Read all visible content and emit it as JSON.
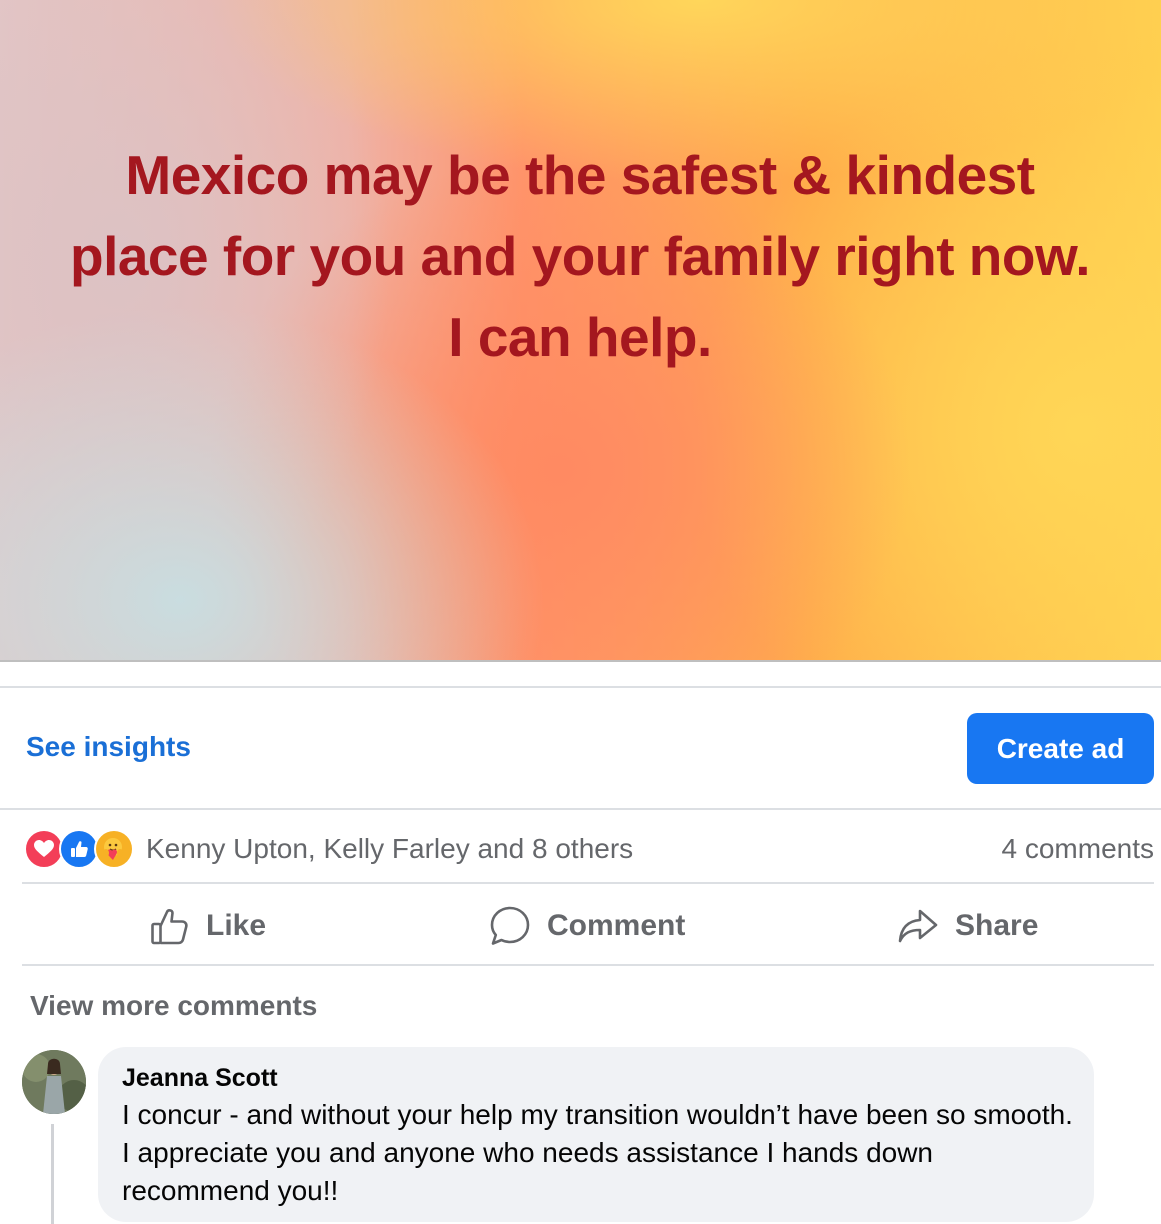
{
  "post": {
    "text": "Mexico may be the safest & kindest place for you and your family right now. I can help."
  },
  "insights": {
    "see_insights_label": "See insights",
    "create_ad_label": "Create ad"
  },
  "reactions": {
    "types": [
      "love",
      "like",
      "care"
    ],
    "summary": "Kenny Upton, Kelly Farley and 8 others",
    "comment_count": "4 comments"
  },
  "actions": {
    "like_label": "Like",
    "comment_label": "Comment",
    "share_label": "Share"
  },
  "comments": {
    "view_more_label": "View more comments",
    "items": [
      {
        "author": "Jeanna Scott",
        "text": "I concur - and without your help my transition wouldn’t have been so smooth. I appreciate you and anyone who needs assistance I hands down recommend you!!"
      }
    ]
  },
  "colors": {
    "post_text": "#a4171f",
    "link_blue": "#1a6fd6",
    "button_blue": "#1877f2",
    "secondary_text": "#65676b"
  }
}
